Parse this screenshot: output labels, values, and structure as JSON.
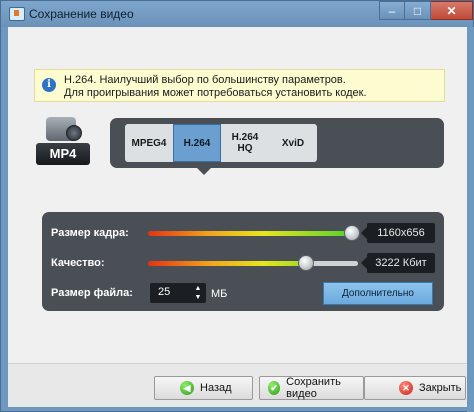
{
  "window": {
    "title": "Сохранение видео",
    "controls": {
      "minimize": "–",
      "maximize": "□",
      "close": "✕"
    }
  },
  "info": {
    "icon": "info-icon",
    "icon_glyph": "i",
    "line1": "H.264. Наилучший выбор по большинству параметров.",
    "line2": "Для проигрывания может потребоваться установить кодек."
  },
  "format": {
    "icon": "camcorder-icon",
    "label": "MP4"
  },
  "codecs": {
    "tabs": [
      {
        "label": "MPEG4",
        "active": false
      },
      {
        "label": "H.264",
        "active": true
      },
      {
        "label": "H.264\nHQ",
        "active": false
      },
      {
        "label": "XviD",
        "active": false
      }
    ]
  },
  "settings": {
    "frame_size": {
      "label": "Размер кадра:",
      "value": "1160x656",
      "level": 0.97
    },
    "quality": {
      "label": "Качество:",
      "value": "3222 Кбит",
      "level": 0.75
    },
    "file_size": {
      "label": "Размер файла:",
      "value": "25",
      "unit": "МБ",
      "up": "▲",
      "down": "▼"
    },
    "more_button": "Дополнительно"
  },
  "footer": {
    "back": {
      "label": "Назад",
      "icon": "back-arrow-icon",
      "glyph": "◀"
    },
    "save": {
      "label": "Сохранить видео",
      "icon": "check-icon",
      "glyph": "✔"
    },
    "close": {
      "label": "Закрыть",
      "icon": "close-x-icon",
      "glyph": "✕"
    }
  },
  "colors": {
    "accent": "#6a9fd0",
    "panel": "#4a4f55",
    "titlebar": "#6e98bf"
  }
}
